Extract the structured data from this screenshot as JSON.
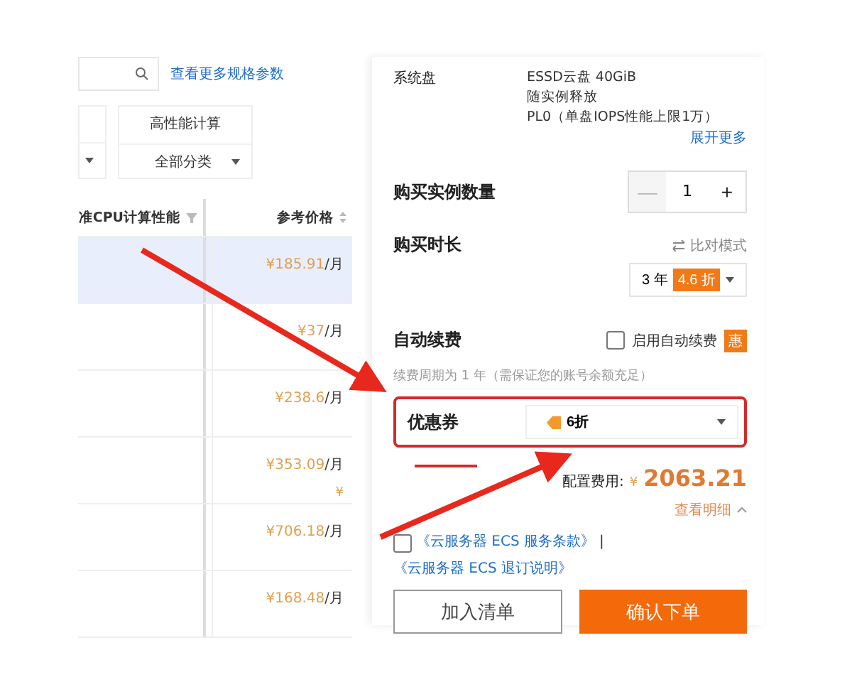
{
  "spec_link": "查看更多规格参数",
  "filters": [
    {
      "title": "高性能计算",
      "value": "全部分类"
    }
  ],
  "table": {
    "columns": [
      "准CPU计算性能",
      "参考价格"
    ],
    "rows": [
      {
        "price": "¥185.91",
        "unit": "/月",
        "selected": true
      },
      {
        "price": "¥37",
        "unit": "/月",
        "selected": false
      },
      {
        "price": "¥238.6",
        "unit": "/月",
        "selected": false
      },
      {
        "price": "¥353.09",
        "unit": "/月",
        "note": "¥",
        "selected": false
      },
      {
        "price": "¥706.18",
        "unit": "/月",
        "selected": false
      },
      {
        "price": "¥168.48",
        "unit": "/月",
        "selected": false
      }
    ]
  },
  "system_disk": {
    "label": "系统盘",
    "lines": [
      "ESSD云盘 40GiB",
      "随实例释放",
      "PL0（单盘IOPS性能上限1万）"
    ],
    "expand": "展开更多"
  },
  "quantity": {
    "label": "购买实例数量",
    "minus": "—",
    "value": "1",
    "plus": "+",
    "minus_disabled": true
  },
  "duration": {
    "label": "购买时长",
    "compare": "比对模式",
    "value": "3 年",
    "badge": "4.6 折"
  },
  "auto_renew": {
    "label": "自动续费",
    "checkbox": "启用自动续费",
    "checked": false,
    "badge": "惠",
    "note": "续费周期为 1 年（需保证您的账号余额充足）"
  },
  "coupon": {
    "label": "优惠券",
    "value": "6折",
    "highlighted": true
  },
  "cost": {
    "label": "配置费用:",
    "currency": "¥",
    "amount": "2063.21",
    "details": "查看明细"
  },
  "agreement": {
    "checked": false,
    "links": [
      "《云服务器 ECS 服务条款》",
      "《云服务器 ECS 退订说明》"
    ],
    "separator": "|"
  },
  "buttons": [
    {
      "label": "加入清单",
      "kind": "secondary"
    },
    {
      "label": "确认下单",
      "kind": "primary"
    }
  ]
}
